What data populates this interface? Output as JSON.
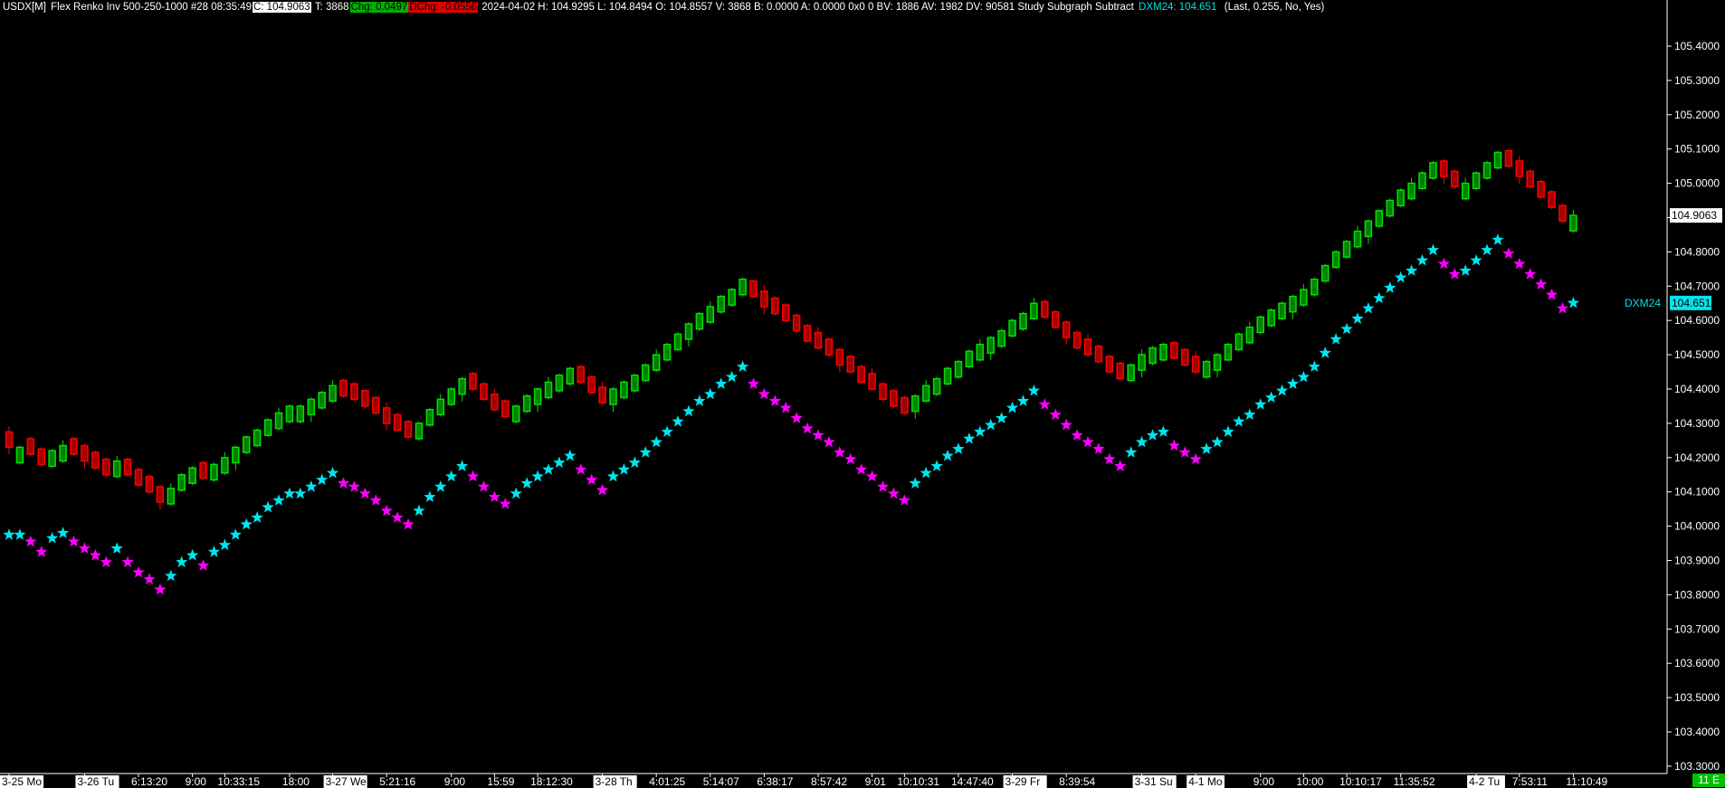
{
  "header": {
    "symbol": "USDX[M]",
    "chart_desc": "Flex Renko Inv 500-250-1000 #28 08:35:49",
    "close": "C: 104.9063",
    "trades": "T: 3868",
    "chg": "Chg: 0.0497",
    "dchg": "DChg: -0.0556",
    "details": "2024-04-02 H: 104.9295 L: 104.8494 O: 104.8557 V: 3868 B: 0.0000 A: 0.0000 0x0 0 BV: 1886 AV: 1982 DV: 90581 Study Subgraph Subtract",
    "study_value": "DXM24: 104.651",
    "study_params": "(Last, 0.255, No, Yes)"
  },
  "status_badge": "11 E",
  "colors": {
    "up_fill": "#008000",
    "up_line": "#00e000",
    "down_fill": "#a00000",
    "down_line": "#ff0000",
    "star_up": "#00e5ee",
    "star_down": "#ff00ff"
  },
  "chart_data": {
    "type": "candlestick",
    "title": "USDX[M] Flex Renko Inv 500-250-1000",
    "brick_body": 0.045,
    "ylim": [
      103.3,
      105.45
    ],
    "y_ticks": [
      "105.4000",
      "105.3000",
      "105.2000",
      "105.1000",
      "105.0000",
      "104.9000",
      "104.8000",
      "104.7000",
      "104.6000",
      "104.5000",
      "104.4000",
      "104.3000",
      "104.2000",
      "104.1000",
      "104.0000",
      "103.9000",
      "103.8000",
      "103.7000",
      "103.6000",
      "103.5000",
      "103.4000",
      "103.3000"
    ],
    "closes": [
      104.23,
      104.23,
      104.21,
      104.18,
      104.22,
      104.235,
      104.21,
      104.19,
      104.17,
      104.15,
      104.19,
      104.15,
      104.12,
      104.1,
      104.07,
      104.11,
      104.15,
      104.17,
      104.14,
      104.18,
      104.2,
      104.23,
      104.26,
      104.28,
      104.31,
      104.33,
      104.35,
      104.35,
      104.37,
      104.39,
      104.41,
      104.38,
      104.37,
      104.35,
      104.33,
      104.3,
      104.28,
      104.26,
      104.3,
      104.34,
      104.37,
      104.4,
      104.43,
      104.4,
      104.37,
      104.34,
      104.32,
      104.35,
      104.38,
      104.4,
      104.42,
      104.44,
      104.46,
      104.42,
      104.39,
      104.36,
      104.4,
      104.42,
      104.44,
      104.47,
      104.5,
      104.53,
      104.56,
      104.59,
      104.62,
      104.64,
      104.67,
      104.69,
      104.72,
      104.67,
      104.64,
      104.62,
      104.6,
      104.57,
      104.54,
      104.52,
      104.5,
      104.47,
      104.45,
      104.42,
      104.4,
      104.37,
      104.35,
      104.33,
      104.38,
      104.41,
      104.43,
      104.46,
      104.48,
      104.51,
      104.53,
      104.55,
      104.57,
      104.6,
      104.62,
      104.65,
      104.61,
      104.58,
      104.55,
      104.52,
      104.5,
      104.48,
      104.45,
      104.43,
      104.47,
      104.5,
      104.52,
      104.53,
      104.49,
      104.47,
      104.45,
      104.48,
      104.5,
      104.53,
      104.56,
      104.58,
      104.61,
      104.63,
      104.65,
      104.67,
      104.69,
      104.72,
      104.76,
      104.8,
      104.83,
      104.86,
      104.89,
      104.92,
      104.95,
      104.98,
      105.0,
      105.03,
      105.06,
      105.02,
      104.99,
      105.0,
      105.03,
      105.06,
      105.09,
      105.05,
      105.02,
      104.99,
      104.96,
      104.93,
      104.89,
      104.9063
    ],
    "study": {
      "name": "DXM24",
      "subtract_offset": 0.255,
      "last_value": 104.651,
      "last_label": "104.651",
      "marker": "star"
    },
    "last_price_label": "104.9063",
    "x_labels": [
      {
        "text": "3-25 Mo",
        "bar": 0,
        "date": true
      },
      {
        "text": "3-26 Tu",
        "bar": 7,
        "date": true
      },
      {
        "text": "6:13:20",
        "bar": 12
      },
      {
        "text": "9:00",
        "bar": 17
      },
      {
        "text": "10:33:15",
        "bar": 20
      },
      {
        "text": "18:00",
        "bar": 26
      },
      {
        "text": "3-27 We",
        "bar": 30,
        "date": true
      },
      {
        "text": "5:21:16",
        "bar": 35
      },
      {
        "text": "9:00",
        "bar": 41
      },
      {
        "text": "15:59",
        "bar": 45
      },
      {
        "text": "18:12:30",
        "bar": 49
      },
      {
        "text": "3-28 Th",
        "bar": 55,
        "date": true
      },
      {
        "text": "4:01:25",
        "bar": 60
      },
      {
        "text": "5:14:07",
        "bar": 65
      },
      {
        "text": "6:38:17",
        "bar": 70
      },
      {
        "text": "8:57:42",
        "bar": 75
      },
      {
        "text": "9:01",
        "bar": 80
      },
      {
        "text": "10:10:31",
        "bar": 83
      },
      {
        "text": "14:47:40",
        "bar": 88
      },
      {
        "text": "3-29 Fr",
        "bar": 93,
        "date": true
      },
      {
        "text": "8:39:54",
        "bar": 98
      },
      {
        "text": "3-31 Su",
        "bar": 105,
        "date": true
      },
      {
        "text": "4-1 Mo",
        "bar": 110,
        "date": true
      },
      {
        "text": "9:00",
        "bar": 116
      },
      {
        "text": "10:00",
        "bar": 120
      },
      {
        "text": "10:10:17",
        "bar": 124
      },
      {
        "text": "11:35:52",
        "bar": 129
      },
      {
        "text": "4-2 Tu",
        "bar": 136,
        "date": true
      },
      {
        "text": "7:53:11",
        "bar": 140
      },
      {
        "text": "11:10:49",
        "bar": 145
      }
    ]
  }
}
